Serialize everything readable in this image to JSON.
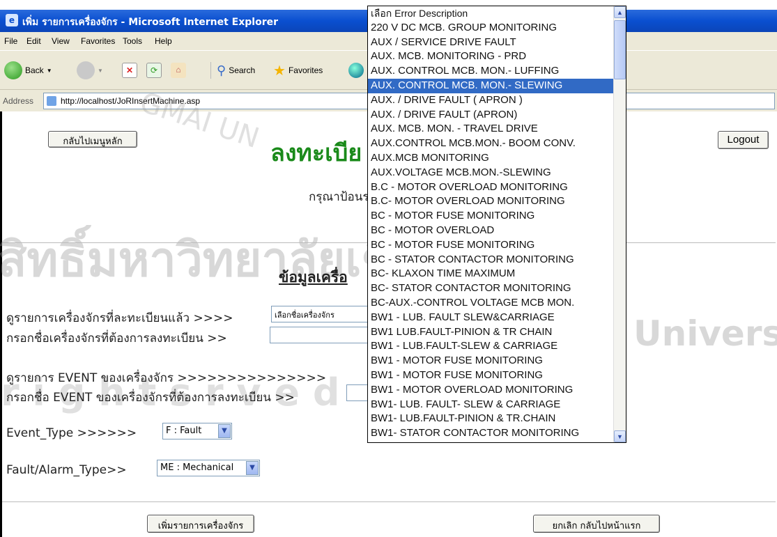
{
  "window": {
    "title": "เพิ่ม รายการเครื่องจักร - Microsoft Internet Explorer"
  },
  "menu": [
    "File",
    "Edit",
    "View",
    "Favorites",
    "Tools",
    "Help"
  ],
  "toolbar": {
    "back": "Back",
    "search": "Search",
    "favorites": "Favorites"
  },
  "address": {
    "label": "Address",
    "url": "http://localhost/JoRInsertMachine.asp"
  },
  "page": {
    "back_menu_button": "กลับไปเมนูหลัก",
    "logout_button": "Logout",
    "heading": "ลงทะเบีย",
    "instruction": "กรุณาป้อนร",
    "section_title": "ข้อมูลเครื่อ",
    "row1_label": "ดูรายการเครื่องจักรที่ละทะเบียนแล้ว >>>>",
    "row1_select": "เลือกชื่อเครื่องจักร",
    "row2_label": "กรอกชื่อเครื่องจักรที่ต้องการลงทะเบียน >>",
    "row3_label": "ดูรายการ EVENT ของเครื่องจักร >>>>>>>>>>>>>>>",
    "row4_label": "กรอกชื่อ EVENT ของเครื่องจักรที่ต้องการลงทะเบียน >>",
    "event_type_label": "Event_Type >>>>>>",
    "event_type_value": "F : Fault",
    "fault_alarm_label": "Fault/Alarm_Type>>",
    "fault_alarm_value": "ME : Mechanical",
    "add_button": "เพิ่มรายการเครื่องจักร",
    "cancel_button": "ยกเลิก กลับไปหน้าแรก"
  },
  "watermark": {
    "line1": "สิทธิ์มหาวิทยาลัยเชียงใหม่",
    "line2": "University",
    "line3": "r i g h t s      r v e d",
    "seal_text": "GMAI UN"
  },
  "dropdown": {
    "selected_index": 5,
    "items": [
      "เลือก Error Description",
      "220 V DC MCB. GROUP MONITORING",
      "AUX / SERVICE DRIVE FAULT",
      "AUX. MCB. MONITORING - PRD",
      "AUX. CONTROL MCB. MON.- LUFFING",
      "AUX. CONTROL MCB. MON.- SLEWING",
      "AUX. / DRIVE FAULT ( APRON )",
      "AUX. / DRIVE FAULT (APRON)",
      "AUX. MCB. MON. - TRAVEL DRIVE",
      "AUX.CONTROL MCB.MON.- BOOM CONV.",
      "AUX.MCB MONITORING",
      "AUX.VOLTAGE MCB.MON.-SLEWING",
      "B.C - MOTOR OVERLOAD MONITORING",
      "B.C- MOTOR OVERLOAD MONITORING",
      "BC - MOTOR FUSE MONITORING",
      "BC - MOTOR OVERLOAD",
      "BC - MOTOR FUSE MONITORING",
      "BC - STATOR CONTACTOR MONITORING",
      "BC- KLAXON TIME MAXIMUM",
      "BC- STATOR CONTACTOR MONITORING",
      "BC-AUX.-CONTROL VOLTAGE MCB MON.",
      "BW1 - LUB. FAULT SLEW&CARRIAGE",
      "BW1 LUB.FAULT-PINION & TR CHAIN",
      "BW1 - LUB.FAULT-SLEW & CARRIAGE",
      "BW1 - MOTOR FUSE MONITORING",
      "BW1 - MOTOR FUSE MONITORING",
      "BW1 - MOTOR OVERLOAD MONITORING",
      "BW1- LUB. FAULT- SLEW & CARRIAGE",
      "BW1- LUB.FAULT-PINION & TR.CHAIN",
      "BW1- STATOR CONTACTOR MONITORING"
    ]
  }
}
